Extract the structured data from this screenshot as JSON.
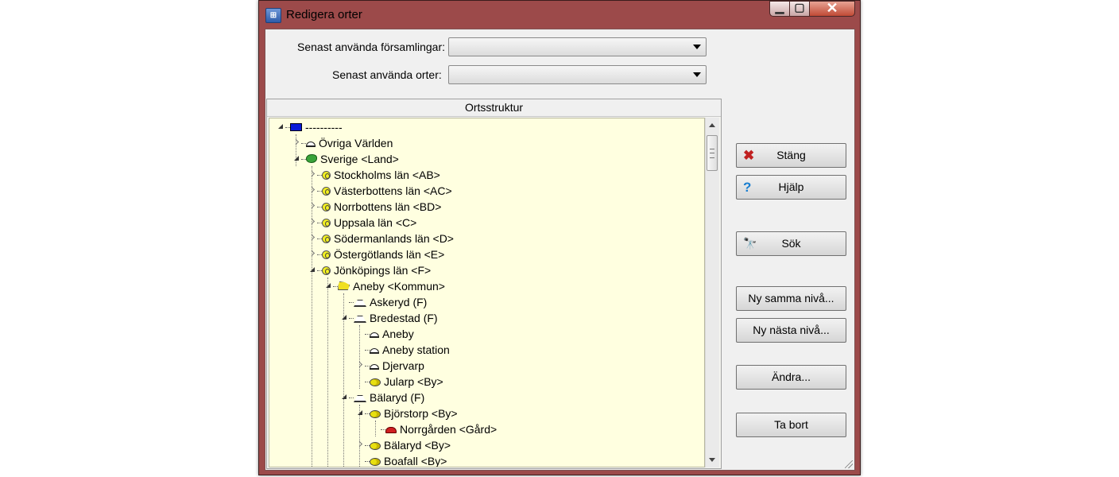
{
  "window": {
    "title": "Redigera orter",
    "app_icon": "registry-icon",
    "controls": [
      "minimize",
      "maximize",
      "close"
    ]
  },
  "fields": {
    "recent_parishes_label": "Senast använda församlingar:",
    "recent_parishes_value": "",
    "recent_places_label": "Senast använda orter:",
    "recent_places_value": ""
  },
  "tree": {
    "header": "Ortsstruktur",
    "nodes": [
      {
        "label": "----------",
        "icon": "root"
      },
      {
        "label": "Övriga Världen",
        "icon": "dome"
      },
      {
        "label": "Sverige <Land>",
        "icon": "land"
      },
      {
        "label": "Stockholms län <AB>",
        "icon": "lan"
      },
      {
        "label": "Västerbottens län <AC>",
        "icon": "lan"
      },
      {
        "label": "Norrbottens län <BD>",
        "icon": "lan"
      },
      {
        "label": "Uppsala län <C>",
        "icon": "lan"
      },
      {
        "label": "Södermanlands län <D>",
        "icon": "lan"
      },
      {
        "label": "Östergötlands län <E>",
        "icon": "lan"
      },
      {
        "label": "Jönköpings län <F>",
        "icon": "lan"
      },
      {
        "label": "Aneby <Kommun>",
        "icon": "kommun"
      },
      {
        "label": "Askeryd (F)",
        "icon": "forsamling"
      },
      {
        "label": "Bredestad (F)",
        "icon": "forsamling"
      },
      {
        "label": "Aneby",
        "icon": "dome"
      },
      {
        "label": "Aneby station",
        "icon": "dome"
      },
      {
        "label": "Djervarp",
        "icon": "dome"
      },
      {
        "label": "Jularp <By>",
        "icon": "by"
      },
      {
        "label": "Bälaryd (F)",
        "icon": "forsamling"
      },
      {
        "label": "Björstorp <By>",
        "icon": "by"
      },
      {
        "label": "Norrgården <Gård>",
        "icon": "gard"
      },
      {
        "label": "Bälaryd <By>",
        "icon": "by"
      },
      {
        "label": "Boafall <By>",
        "icon": "by"
      }
    ]
  },
  "buttons": {
    "close": "Stäng",
    "help": "Hjälp",
    "search": "Sök",
    "new_same_level": "Ny samma nivå...",
    "new_next_level": "Ny nästa nivå...",
    "edit": "Ändra...",
    "delete": "Ta bort"
  }
}
